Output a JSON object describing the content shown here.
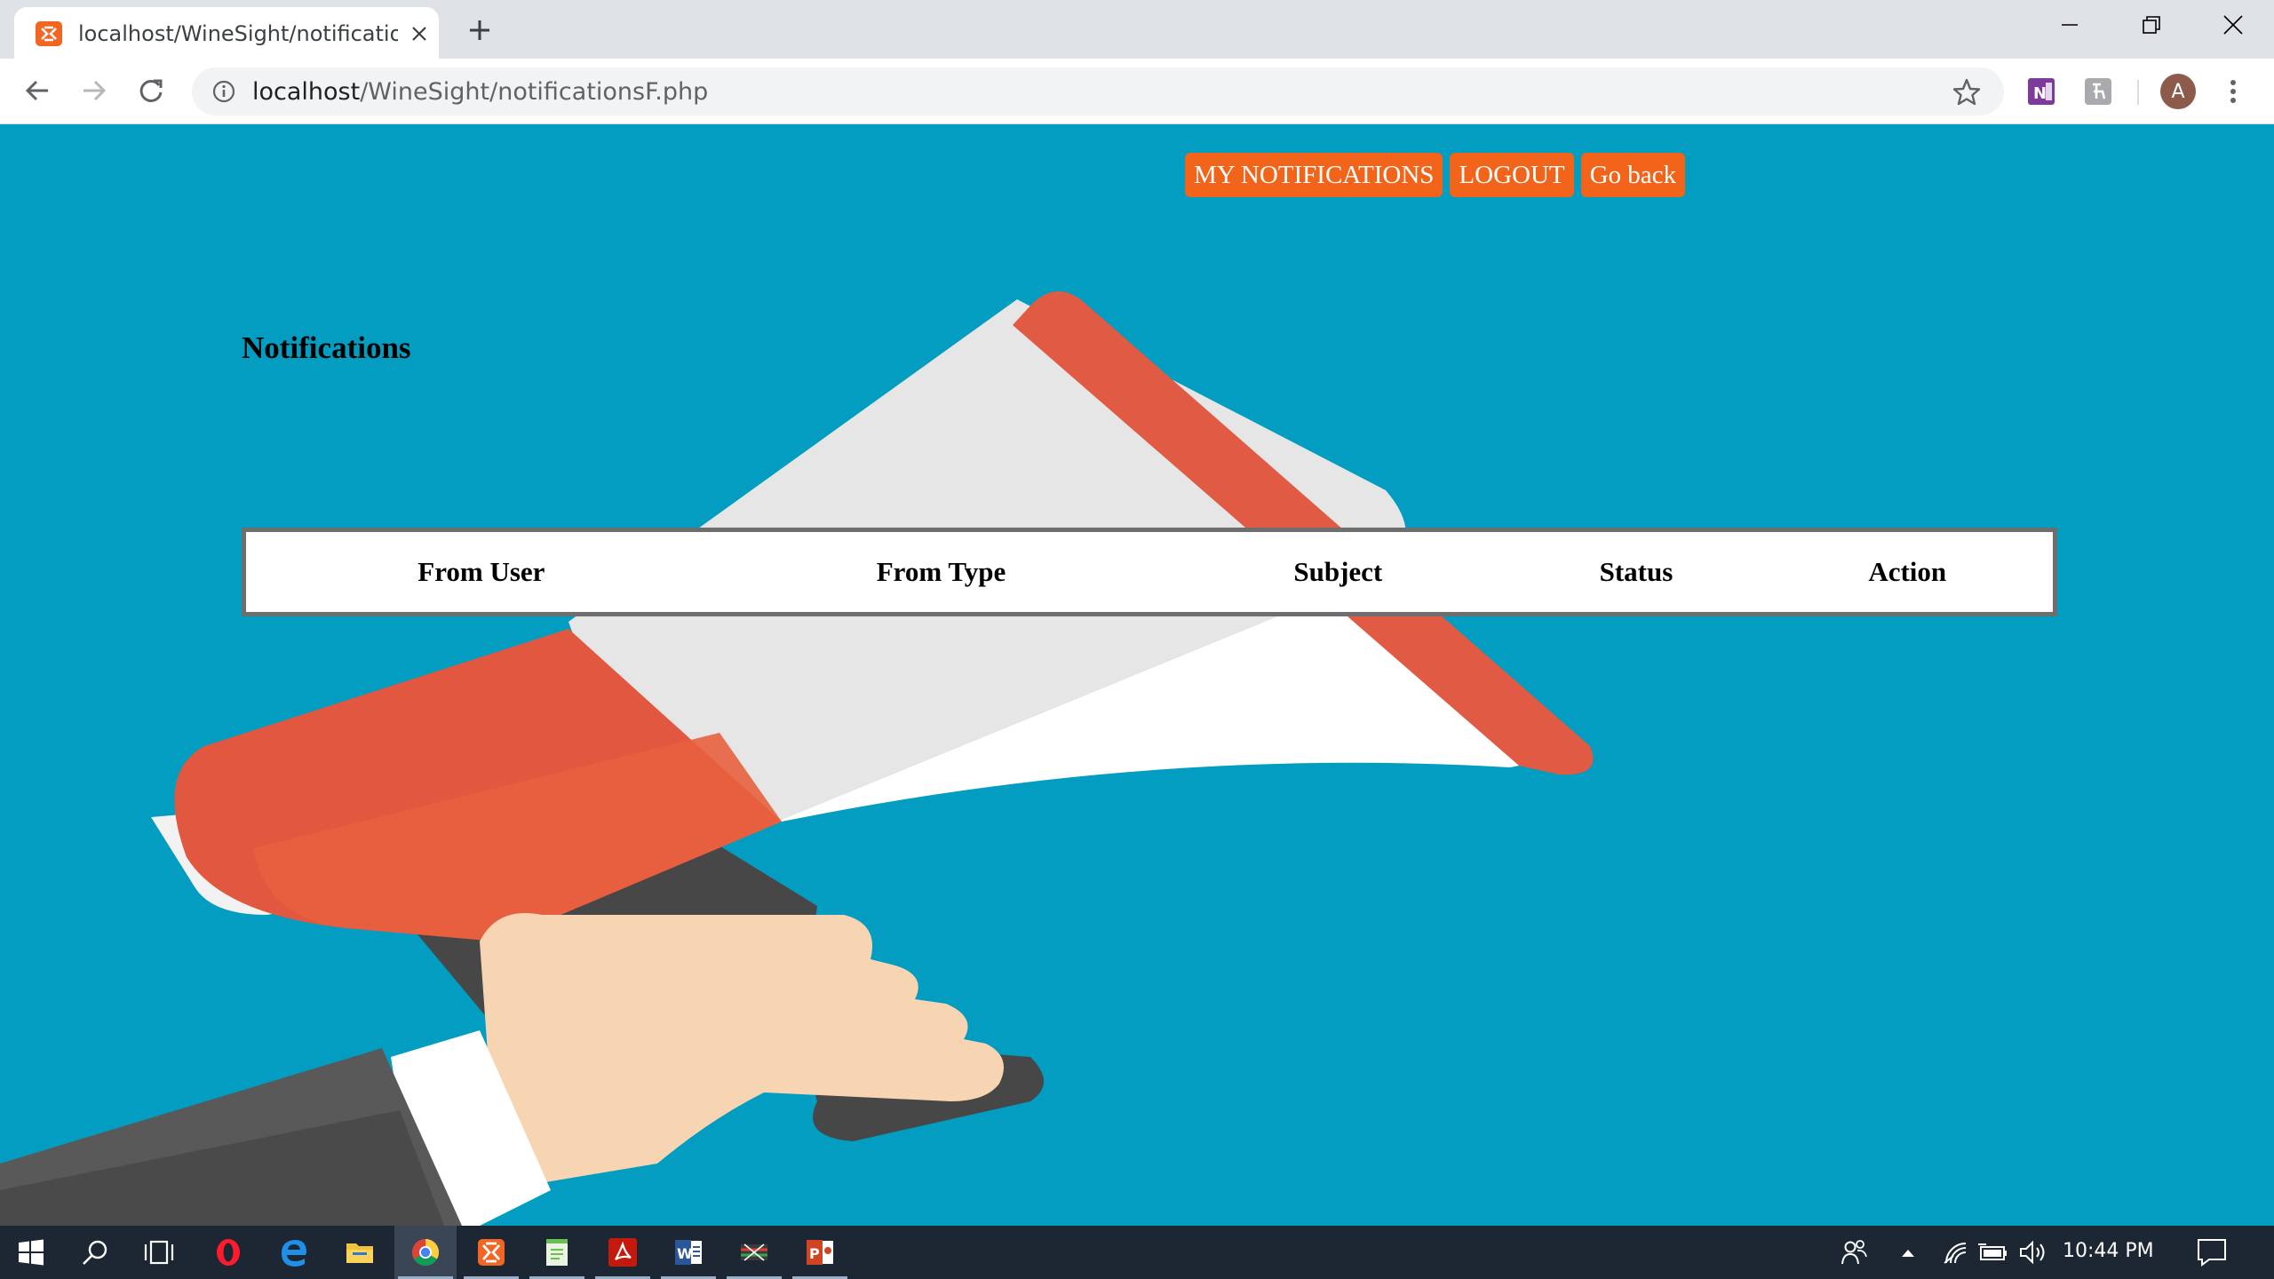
{
  "browser": {
    "tab_title": "localhost/WineSight/notificationsF.php",
    "url_host": "localhost",
    "url_path": "/WineSight/notificationsF.php",
    "profile_initial": "A",
    "extensions": [
      "onenote-icon",
      "extension-icon"
    ]
  },
  "page": {
    "nav": {
      "my_notifications": "MY NOTIFICATIONS",
      "logout": "LOGOUT",
      "go_back": "Go back"
    },
    "heading": "Notifications",
    "table": {
      "headers": [
        "From User",
        "From Type",
        "Subject",
        "Status",
        "Action"
      ],
      "rows": []
    },
    "colors": {
      "background": "#039dc1",
      "nav_button": "#f26419"
    }
  },
  "taskbar": {
    "apps": [
      "start-icon",
      "search-icon",
      "task-view-icon",
      "opera-icon",
      "edge-icon",
      "file-explorer-icon",
      "chrome-icon",
      "xampp-icon",
      "notepad-icon",
      "acrobat-icon",
      "word-icon",
      "app-icon",
      "powerpoint-icon"
    ],
    "time": "10:44 PM"
  }
}
